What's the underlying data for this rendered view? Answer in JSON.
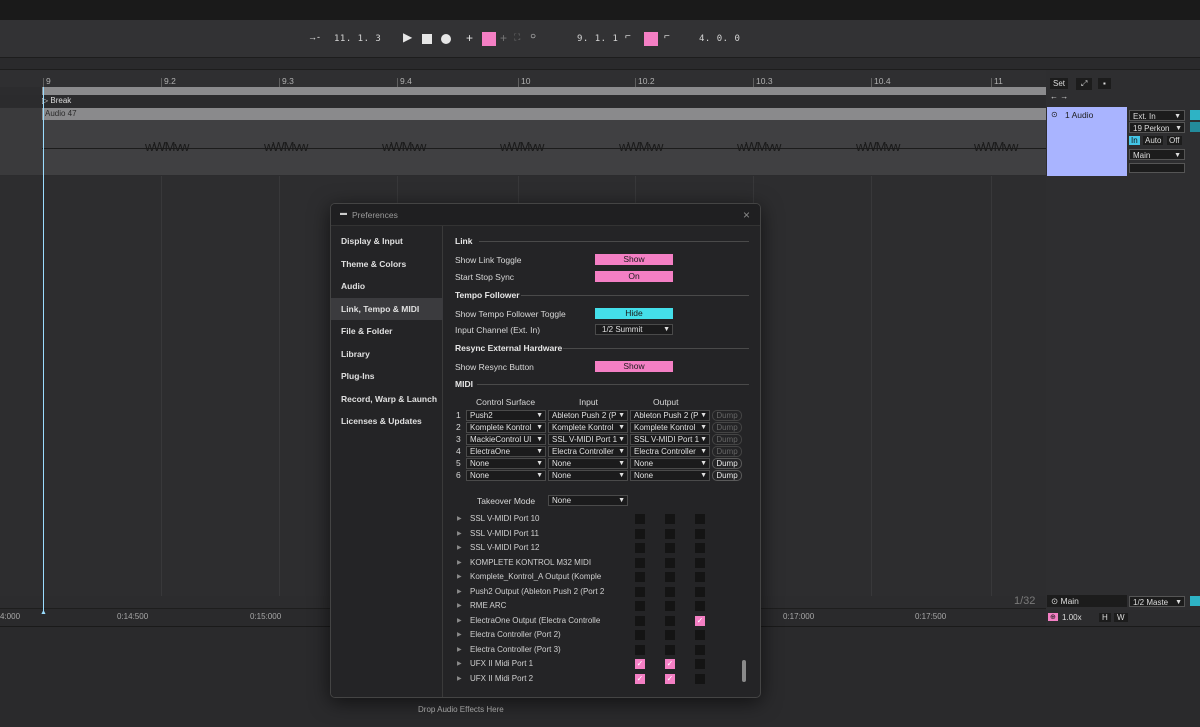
{
  "transport": {
    "arrangement_position": "11. 1. 3",
    "loop_start": "9. 1. 1",
    "loop_length": "4. 0. 0"
  },
  "ruler": {
    "bars": [
      "9",
      "9.2",
      "9.3",
      "9.4",
      "10",
      "10.2",
      "10.3",
      "10.4",
      "11"
    ],
    "locator": "Break",
    "set_button": "Set"
  },
  "clip": {
    "name": "Audio 47"
  },
  "track": {
    "name": "1 Audio",
    "input_type": "Ext. In",
    "input_channel": "19 Perkon",
    "monitor_in": "In",
    "monitor_auto": "Auto",
    "monitor_off": "Off",
    "output": "Main"
  },
  "master": {
    "page_counter": "1/32",
    "name": "Main",
    "output": "1/2 Maste",
    "tempo_scale": "1.00x",
    "h_button": "H",
    "w_button": "W"
  },
  "time_ruler": [
    "4:000",
    "0:14:500",
    "0:15:000",
    "0:17:000",
    "0:17:500"
  ],
  "bottom": {
    "drop_hint": "Drop Audio Effects Here"
  },
  "prefs": {
    "title": "Preferences",
    "nav": [
      "Display & Input",
      "Theme & Colors",
      "Audio",
      "Link, Tempo & MIDI",
      "File & Folder",
      "Library",
      "Plug-Ins",
      "Record, Warp & Launch",
      "Licenses & Updates"
    ],
    "link": {
      "section": "Link",
      "show_toggle_label": "Show Link Toggle",
      "show_toggle_value": "Show",
      "start_stop_label": "Start Stop Sync",
      "start_stop_value": "On"
    },
    "tempo": {
      "section": "Tempo Follower",
      "show_toggle_label": "Show Tempo Follower Toggle",
      "show_toggle_value": "Hide",
      "input_label": "Input Channel (Ext. In)",
      "input_value": "1/2 Summit"
    },
    "resync": {
      "section": "Resync External Hardware",
      "show_label": "Show Resync Button",
      "show_value": "Show"
    },
    "midi": {
      "section": "MIDI",
      "col_surface": "Control Surface",
      "col_input": "Input",
      "col_output": "Output",
      "rows": [
        {
          "num": "1",
          "surface": "Push2",
          "input": "Ableton Push 2 (P",
          "output": "Ableton Push 2 (P",
          "dump": "Dump"
        },
        {
          "num": "2",
          "surface": "Komplete Kontrol",
          "input": "Komplete Kontrol",
          "output": "Komplete Kontrol",
          "dump": "Dump"
        },
        {
          "num": "3",
          "surface": "MackieControl UI",
          "input": "SSL V-MIDI Port 1",
          "output": "SSL V-MIDI Port 1",
          "dump": "Dump"
        },
        {
          "num": "4",
          "surface": "ElectraOne",
          "input": "Electra Controller",
          "output": "Electra Controller",
          "dump": "Dump"
        },
        {
          "num": "5",
          "surface": "None",
          "input": "None",
          "output": "None",
          "dump": "Dump"
        },
        {
          "num": "6",
          "surface": "None",
          "input": "None",
          "output": "None",
          "dump": "Dump"
        }
      ],
      "takeover_label": "Takeover Mode",
      "takeover_value": "None",
      "ports": [
        {
          "name": "SSL V-MIDI Port 10",
          "track": false,
          "sync": false,
          "remote": false
        },
        {
          "name": "SSL V-MIDI Port 11",
          "track": false,
          "sync": false,
          "remote": false
        },
        {
          "name": "SSL V-MIDI Port 12",
          "track": false,
          "sync": false,
          "remote": false
        },
        {
          "name": "KOMPLETE KONTROL M32 MIDI",
          "track": false,
          "sync": false,
          "remote": false
        },
        {
          "name": "Komplete_Kontrol_A Output (Komple",
          "track": false,
          "sync": false,
          "remote": false
        },
        {
          "name": "Push2 Output (Ableton Push 2 (Port 2",
          "track": false,
          "sync": false,
          "remote": false
        },
        {
          "name": "RME ARC",
          "track": false,
          "sync": false,
          "remote": false
        },
        {
          "name": "ElectraOne Output (Electra Controlle",
          "track": false,
          "sync": false,
          "remote": true
        },
        {
          "name": "Electra Controller (Port 2)",
          "track": false,
          "sync": false,
          "remote": false
        },
        {
          "name": "Electra Controller (Port 3)",
          "track": false,
          "sync": false,
          "remote": false
        },
        {
          "name": "UFX II Midi Port 1",
          "track": true,
          "sync": true,
          "remote": false
        },
        {
          "name": "UFX II Midi Port 2",
          "track": true,
          "sync": true,
          "remote": false
        }
      ]
    }
  }
}
